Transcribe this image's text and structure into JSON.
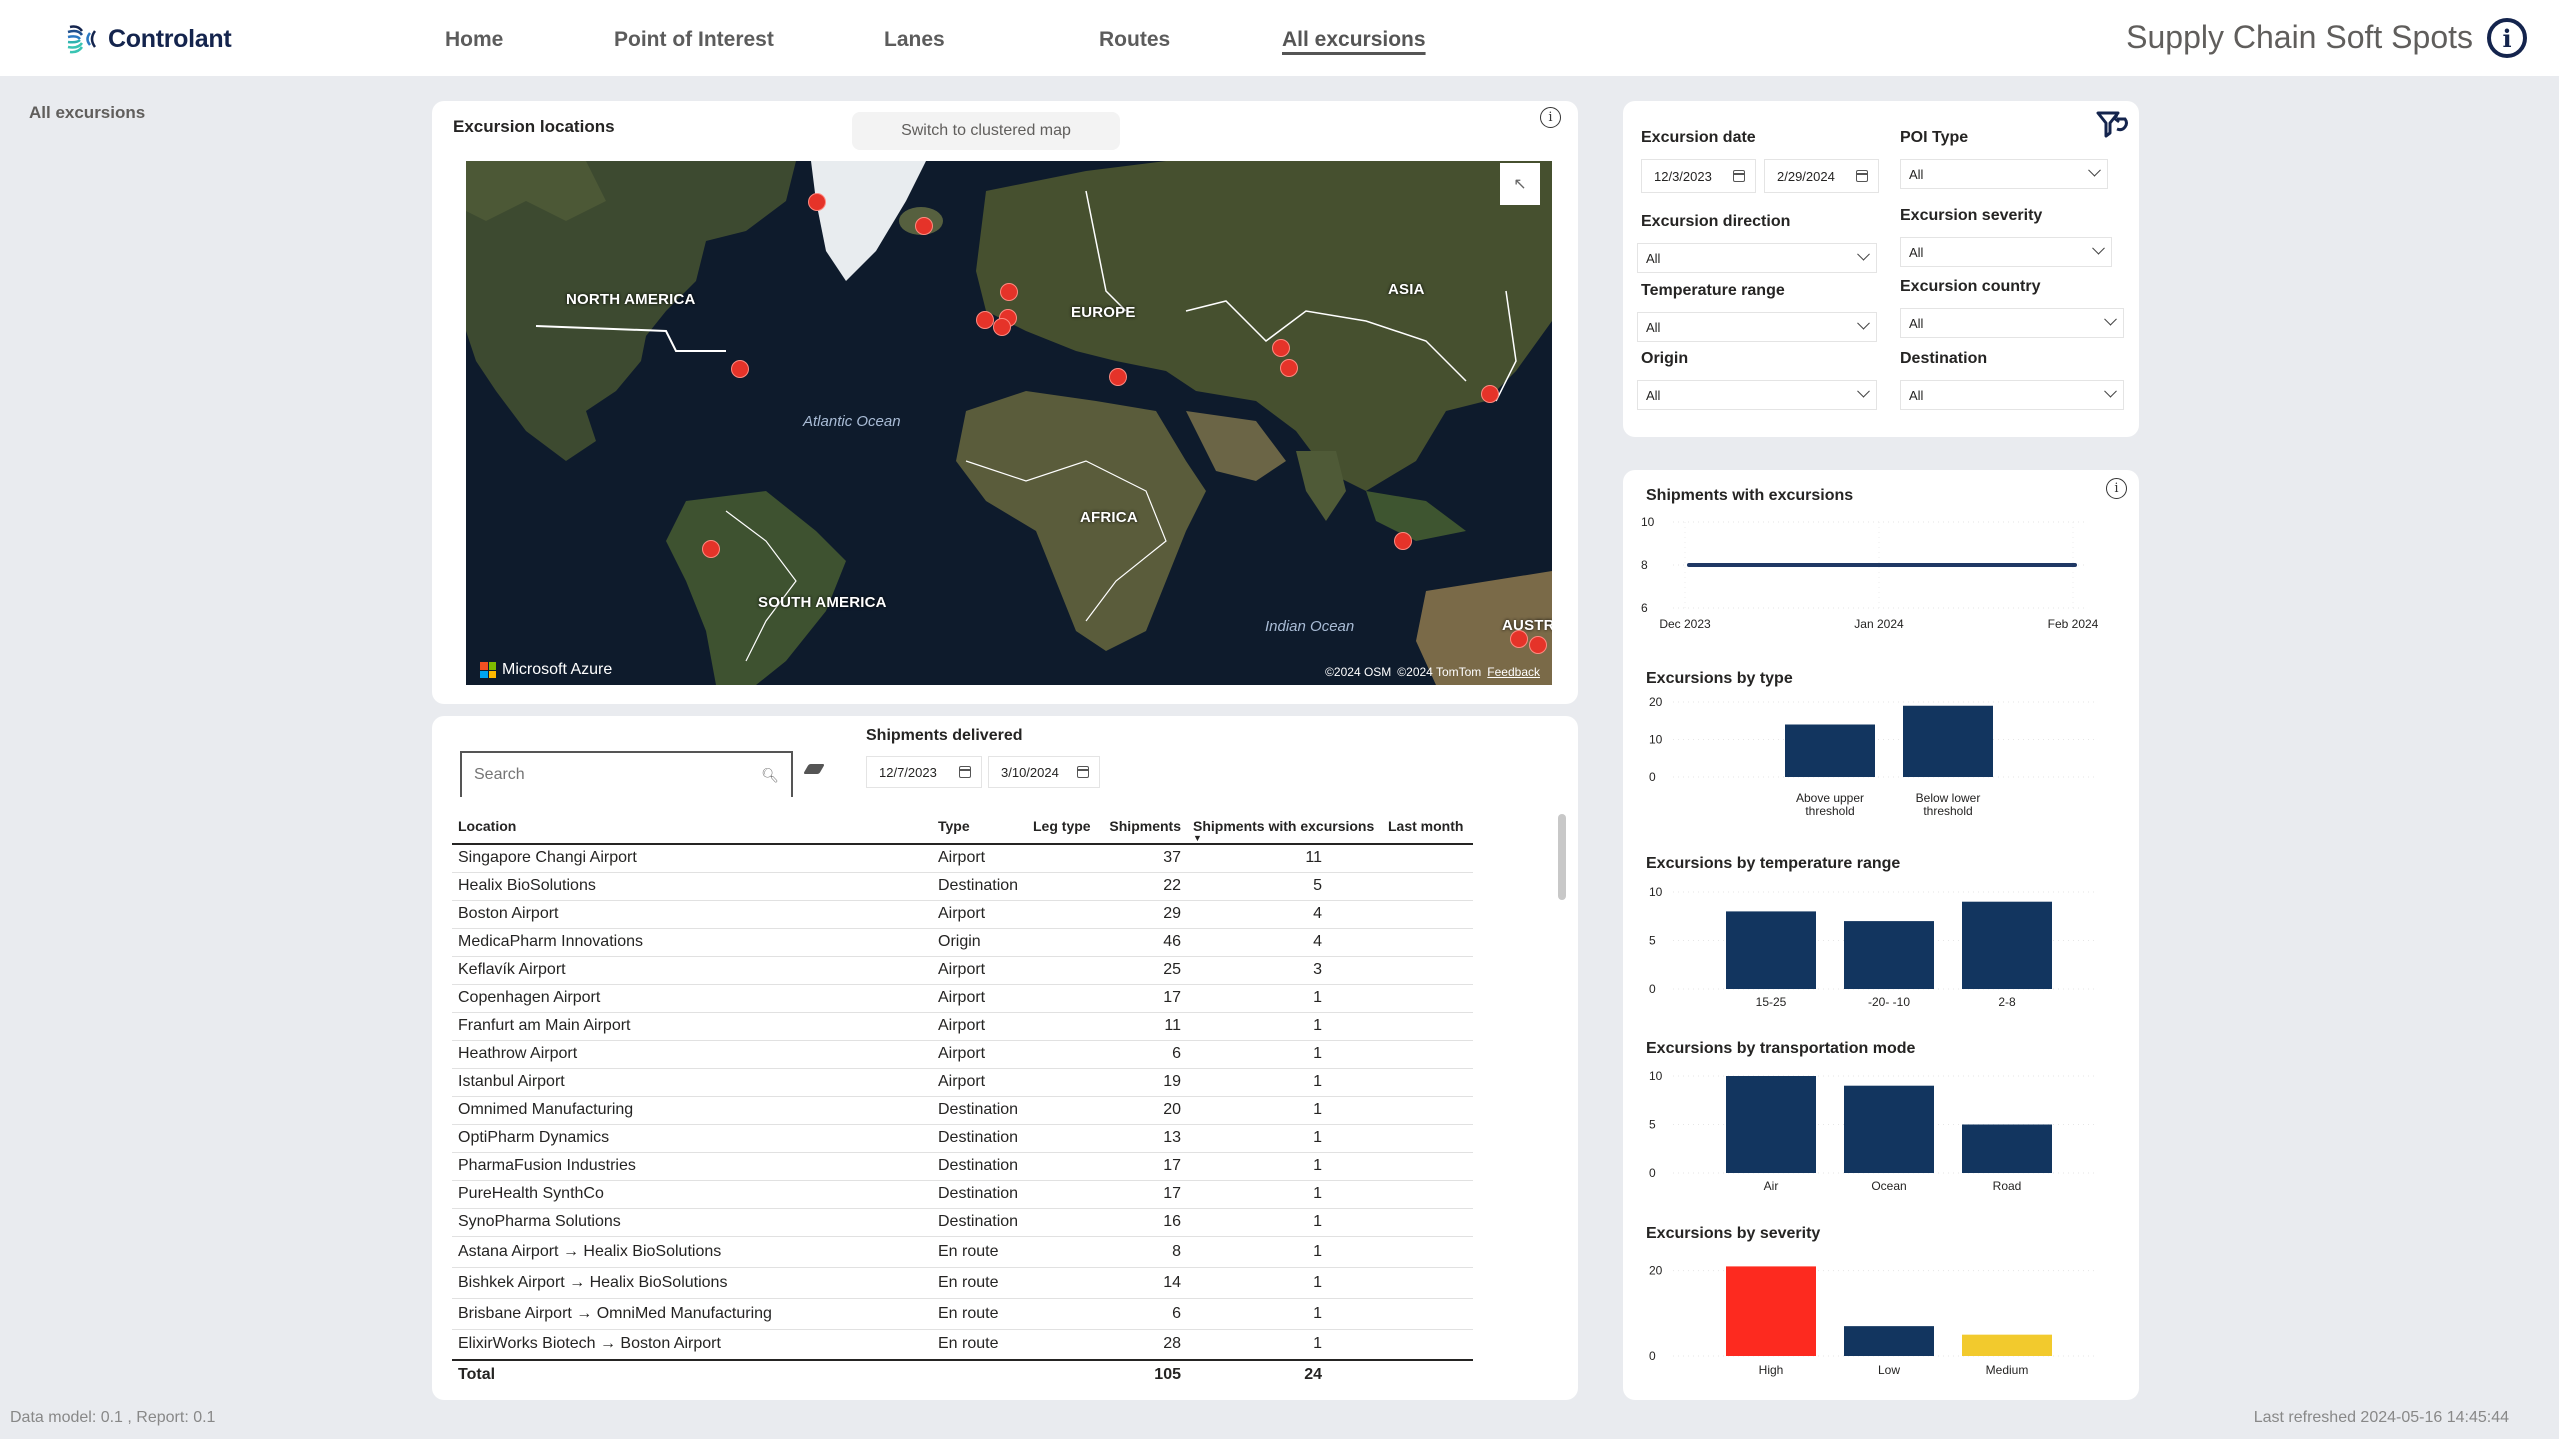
{
  "header": {
    "logo_text": "Controlant",
    "nav": [
      {
        "label": "Home",
        "active": false
      },
      {
        "label": "Point of Interest",
        "active": false
      },
      {
        "label": "Lanes",
        "active": false
      },
      {
        "label": "Routes",
        "active": false
      },
      {
        "label": "All excursions",
        "active": true
      }
    ],
    "app_title": "Supply Chain Soft Spots",
    "info_icon": "info-icon"
  },
  "page_label": "All excursions",
  "map_card": {
    "title": "Excursion locations",
    "switch_button": "Switch to clustered map",
    "labels": {
      "north_america": "NORTH AMERICA",
      "europe": "EUROPE",
      "asia": "ASIA",
      "africa": "AFRICA",
      "south_america": "SOUTH AMERICA",
      "australia": "AUSTR",
      "atlantic": "Atlantic Ocean",
      "indian": "Indian Ocean"
    },
    "brand": "Microsoft Azure",
    "attribution": [
      "©2024 OSM",
      "©2024 TomTom"
    ],
    "feedback": "Feedback",
    "marker_count": 17,
    "marker_color": "#e53329"
  },
  "table_card": {
    "search_placeholder": "Search",
    "shipments_delivered_label": "Shipments delivered",
    "date_from": "12/7/2023",
    "date_to": "3/10/2024",
    "columns": [
      "Location",
      "Type",
      "Leg type",
      "Shipments",
      "Shipments with excursions",
      "Last month"
    ],
    "sorted_column": "Shipments with excursions",
    "rows": [
      {
        "location": "Singapore Changi Airport",
        "type": "Airport",
        "leg_type": "",
        "shipments": "37",
        "with_excursions": "11",
        "last_month": ""
      },
      {
        "location": "Healix BioSolutions",
        "type": "Destination",
        "leg_type": "",
        "shipments": "22",
        "with_excursions": "5",
        "last_month": ""
      },
      {
        "location": "Boston Airport",
        "type": "Airport",
        "leg_type": "",
        "shipments": "29",
        "with_excursions": "4",
        "last_month": ""
      },
      {
        "location": "MedicaPharm Innovations",
        "type": "Origin",
        "leg_type": "",
        "shipments": "46",
        "with_excursions": "4",
        "last_month": ""
      },
      {
        "location": "Keflavík Airport",
        "type": "Airport",
        "leg_type": "",
        "shipments": "25",
        "with_excursions": "3",
        "last_month": ""
      },
      {
        "location": "Copenhagen Airport",
        "type": "Airport",
        "leg_type": "",
        "shipments": "17",
        "with_excursions": "1",
        "last_month": ""
      },
      {
        "location": "Franfurt am Main Airport",
        "type": "Airport",
        "leg_type": "",
        "shipments": "11",
        "with_excursions": "1",
        "last_month": ""
      },
      {
        "location": "Heathrow Airport",
        "type": "Airport",
        "leg_type": "",
        "shipments": "6",
        "with_excursions": "1",
        "last_month": ""
      },
      {
        "location": "Istanbul Airport",
        "type": "Airport",
        "leg_type": "",
        "shipments": "19",
        "with_excursions": "1",
        "last_month": ""
      },
      {
        "location": "Omnimed Manufacturing",
        "type": "Destination",
        "leg_type": "",
        "shipments": "20",
        "with_excursions": "1",
        "last_month": ""
      },
      {
        "location": "OptiPharm Dynamics",
        "type": "Destination",
        "leg_type": "",
        "shipments": "13",
        "with_excursions": "1",
        "last_month": ""
      },
      {
        "location": "PharmaFusion Industries",
        "type": "Destination",
        "leg_type": "",
        "shipments": "17",
        "with_excursions": "1",
        "last_month": ""
      },
      {
        "location": "PureHealth SynthCo",
        "type": "Destination",
        "leg_type": "",
        "shipments": "17",
        "with_excursions": "1",
        "last_month": ""
      },
      {
        "location": "SynoPharma Solutions",
        "type": "Destination",
        "leg_type": "",
        "shipments": "16",
        "with_excursions": "1",
        "last_month": ""
      },
      {
        "location": "Astana Airport → Healix BioSolutions",
        "type": "En route",
        "leg_type": "",
        "shipments": "8",
        "with_excursions": "1",
        "last_month": ""
      },
      {
        "location": "Bishkek Airport → Healix BioSolutions",
        "type": "En route",
        "leg_type": "",
        "shipments": "14",
        "with_excursions": "1",
        "last_month": ""
      },
      {
        "location": "Brisbane Airport → OmniMed Manufacturing",
        "type": "En route",
        "leg_type": "",
        "shipments": "6",
        "with_excursions": "1",
        "last_month": ""
      },
      {
        "location": "ElixirWorks Biotech → Boston Airport",
        "type": "En route",
        "leg_type": "",
        "shipments": "28",
        "with_excursions": "1",
        "last_month": ""
      }
    ],
    "total": {
      "label": "Total",
      "shipments": "105",
      "with_excursions": "24"
    }
  },
  "filters": {
    "excursion_date": {
      "label": "Excursion date",
      "from": "12/3/2023",
      "to": "2/29/2024"
    },
    "poi_type": {
      "label": "POI Type",
      "value": "All"
    },
    "excursion_direction": {
      "label": "Excursion direction",
      "value": "All"
    },
    "excursion_severity": {
      "label": "Excursion severity",
      "value": "All"
    },
    "temperature_range": {
      "label": "Temperature range",
      "value": "All"
    },
    "excursion_country": {
      "label": "Excursion country",
      "value": "All"
    },
    "origin": {
      "label": "Origin",
      "value": "All"
    },
    "destination": {
      "label": "Destination",
      "value": "All"
    }
  },
  "chart_data": [
    {
      "type": "line",
      "title": "Shipments with excursions",
      "x": [
        "Dec 2023",
        "Jan 2024",
        "Feb 2024"
      ],
      "series": [
        {
          "name": "Shipments with excursions",
          "values": [
            8,
            8,
            8
          ]
        }
      ],
      "yticks": [
        6,
        8,
        10
      ],
      "ylim": [
        6,
        10
      ],
      "color": "#1f3864",
      "grid": true
    },
    {
      "type": "bar",
      "title": "Excursions by type",
      "categories": [
        "Above upper threshold",
        "Below lower threshold"
      ],
      "values": [
        14,
        19
      ],
      "yticks": [
        0,
        10,
        20
      ],
      "ylim": [
        0,
        20
      ],
      "colors": [
        "#12355f",
        "#12355f"
      ],
      "grid": true
    },
    {
      "type": "bar",
      "title": "Excursions by temperature range",
      "categories": [
        "15-25",
        "-20- -10",
        "2-8"
      ],
      "values": [
        8,
        7,
        9
      ],
      "yticks": [
        0,
        5,
        10
      ],
      "ylim": [
        0,
        10
      ],
      "colors": [
        "#12355f",
        "#12355f",
        "#12355f"
      ],
      "grid": true
    },
    {
      "type": "bar",
      "title": "Excursions by transportation mode",
      "categories": [
        "Air",
        "Ocean",
        "Road"
      ],
      "values": [
        10,
        9,
        5
      ],
      "yticks": [
        0,
        5,
        10
      ],
      "ylim": [
        0,
        10
      ],
      "colors": [
        "#12355f",
        "#12355f",
        "#12355f"
      ],
      "grid": true
    },
    {
      "type": "bar",
      "title": "Excursions by severity",
      "categories": [
        "High",
        "Low",
        "Medium"
      ],
      "values": [
        21,
        7,
        5
      ],
      "yticks": [
        0,
        20
      ],
      "ylim": [
        0,
        30
      ],
      "colors": [
        "#fd2a1f",
        "#12355f",
        "#f2ca2d"
      ],
      "grid": true
    }
  ],
  "footer": {
    "left": "Data model: 0.1 , Report: 0.1",
    "right": "Last refreshed 2024-05-16 14:45:44"
  }
}
